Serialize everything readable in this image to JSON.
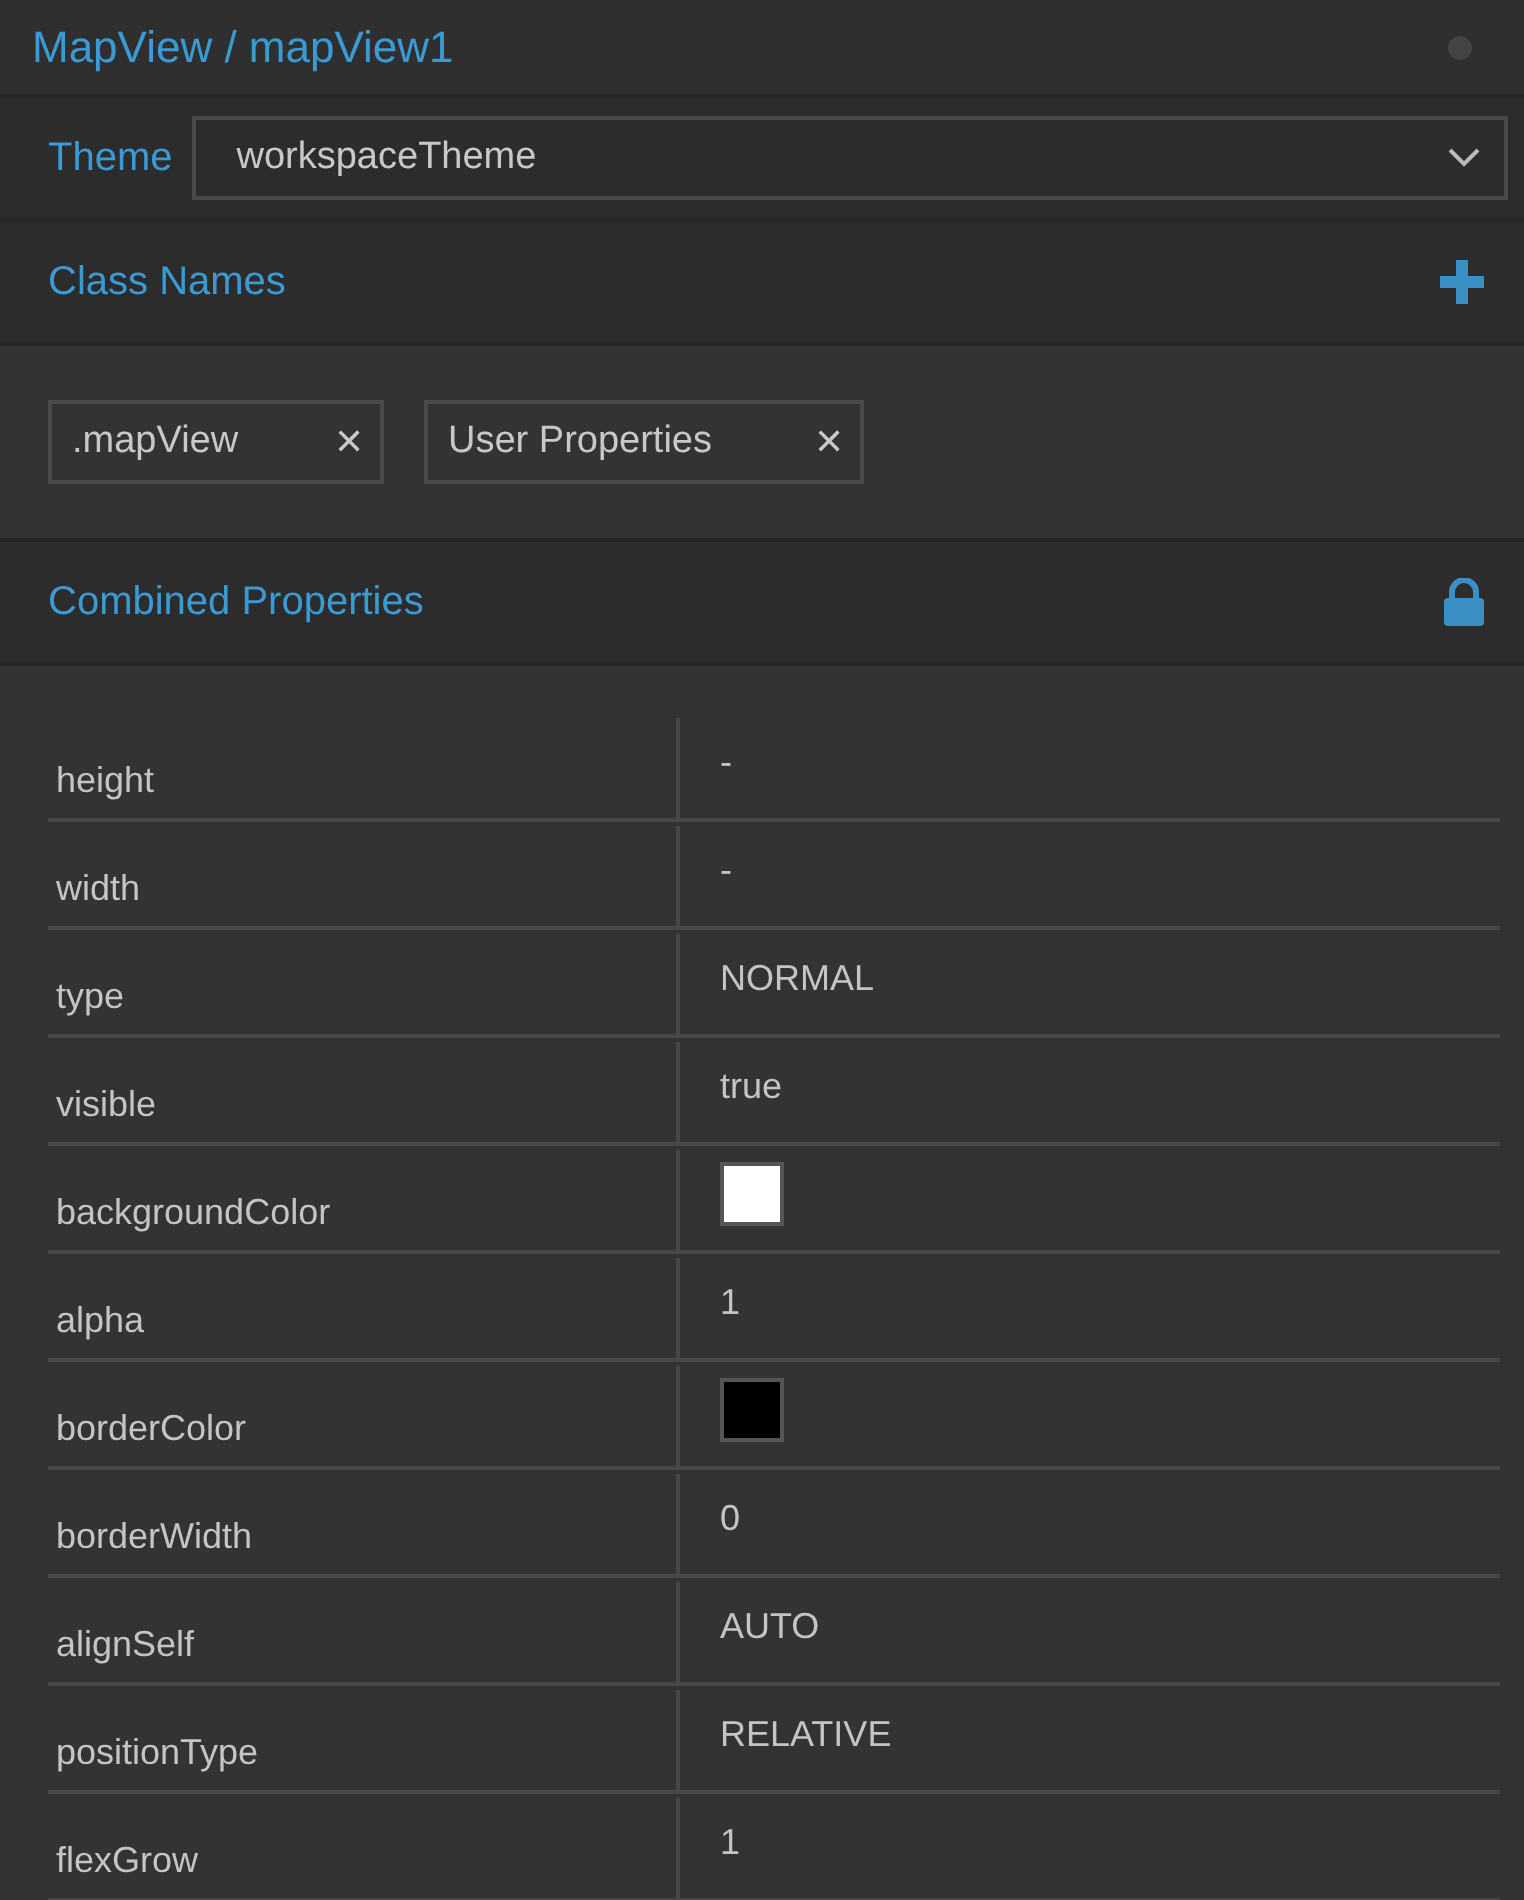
{
  "header": {
    "title": "MapView / mapView1"
  },
  "theme": {
    "label": "Theme",
    "value": "workspaceTheme"
  },
  "class_names": {
    "title": "Class Names",
    "chips": [
      {
        "label": ".mapView",
        "remove": "✕"
      },
      {
        "label": "User Properties",
        "remove": "✕"
      }
    ]
  },
  "combined_properties": {
    "title": "Combined Properties",
    "rows": [
      {
        "name": "height",
        "kind": "text",
        "value": "-"
      },
      {
        "name": "width",
        "kind": "text",
        "value": "-"
      },
      {
        "name": "type",
        "kind": "text",
        "value": "NORMAL"
      },
      {
        "name": "visible",
        "kind": "text",
        "value": "true"
      },
      {
        "name": "backgroundColor",
        "kind": "color",
        "color": "#ffffff"
      },
      {
        "name": "alpha",
        "kind": "text",
        "value": "1"
      },
      {
        "name": "borderColor",
        "kind": "color",
        "color": "#000000"
      },
      {
        "name": "borderWidth",
        "kind": "text",
        "value": "0"
      },
      {
        "name": "alignSelf",
        "kind": "text",
        "value": "AUTO"
      },
      {
        "name": "positionType",
        "kind": "text",
        "value": "RELATIVE"
      },
      {
        "name": "flexGrow",
        "kind": "text",
        "value": "1"
      }
    ]
  }
}
